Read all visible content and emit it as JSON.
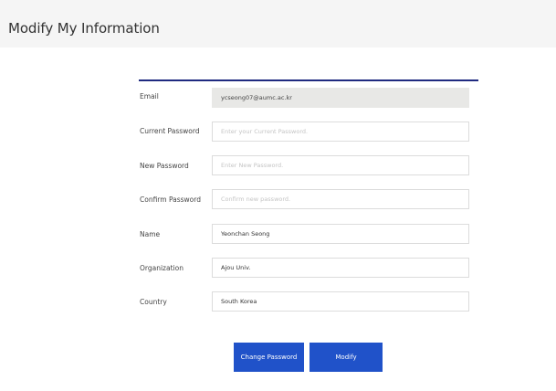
{
  "header": {
    "title": "Modify My Information"
  },
  "form": {
    "email": {
      "label": "Email",
      "value": "ycseong07@aumc.ac.kr"
    },
    "current_password": {
      "label": "Current Password",
      "placeholder": "Enter your Current Password."
    },
    "new_password": {
      "label": "New Password",
      "placeholder": "Enter New Password."
    },
    "confirm_password": {
      "label": "Confirm Password",
      "placeholder": "Confirm new password."
    },
    "name": {
      "label": "Name",
      "value": "Yeonchan Seong"
    },
    "organization": {
      "label": "Organization",
      "value": "Ajou Univ."
    },
    "country": {
      "label": "Country",
      "value": "South Korea"
    }
  },
  "actions": {
    "change_password_label": "Change Password",
    "modify_label": "Modify"
  },
  "colors": {
    "accent_rule": "#1f2a80",
    "button": "#2052c9",
    "header_background": "#f5f5f5",
    "readonly_field": "#e8e8e6"
  }
}
